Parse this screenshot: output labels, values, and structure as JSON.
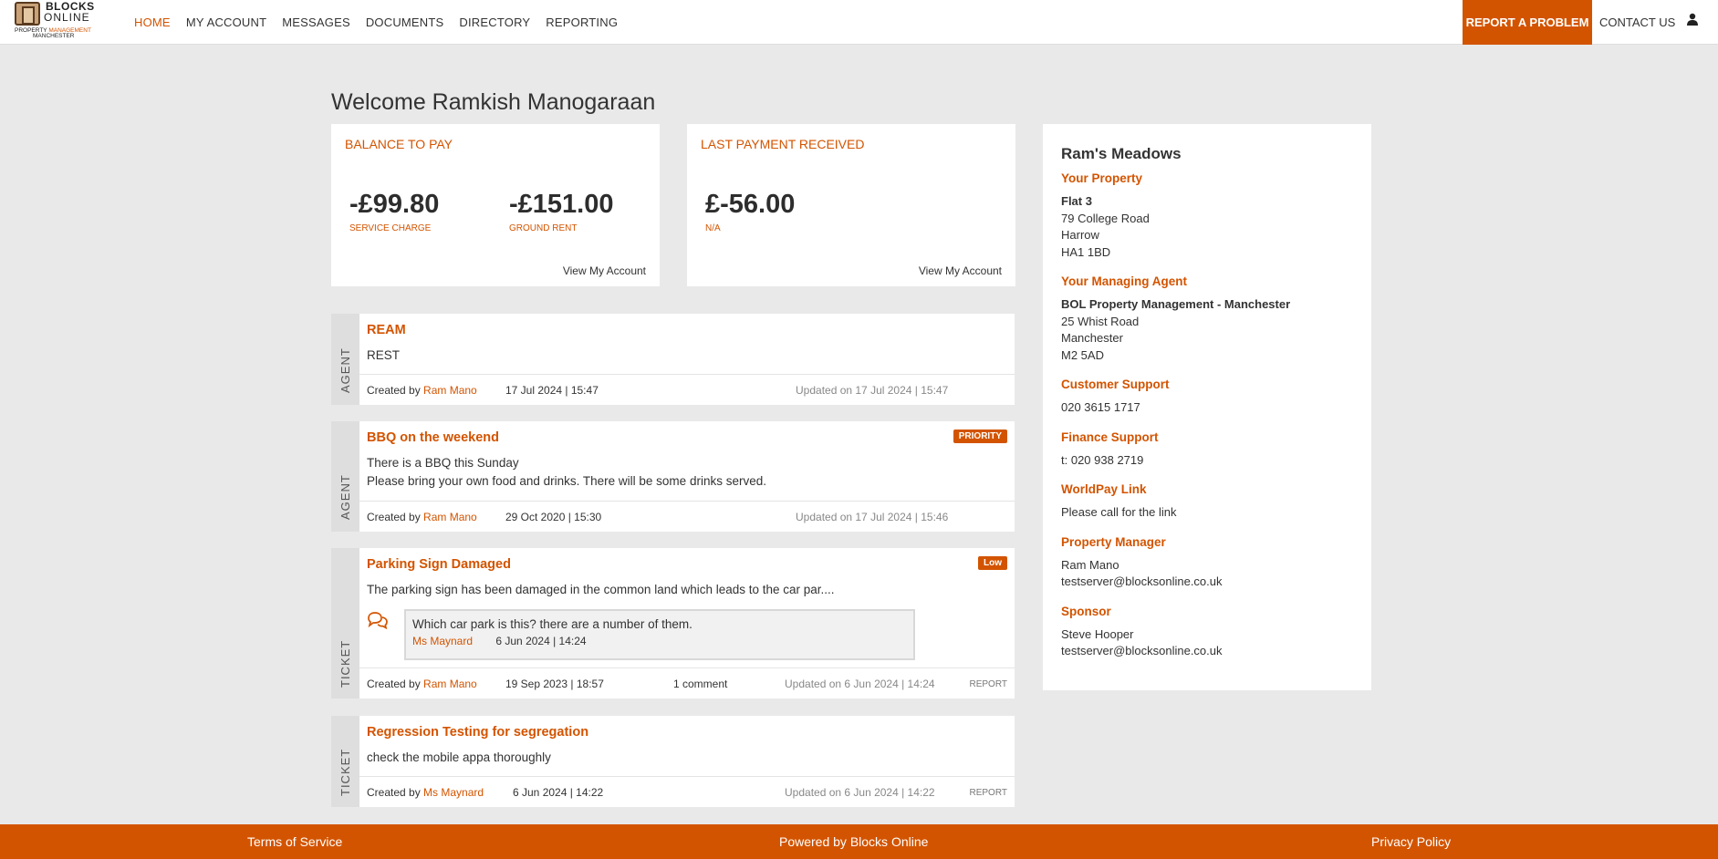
{
  "logo": {
    "line1": "BLOCKS",
    "line2": "ONLINE",
    "line3a": "PROPERTY ",
    "line3b": "MANAGEMENT",
    "line4": "MANCHESTER"
  },
  "nav": {
    "items": [
      {
        "label": "HOME"
      },
      {
        "label": "MY ACCOUNT"
      },
      {
        "label": "MESSAGES"
      },
      {
        "label": "DOCUMENTS"
      },
      {
        "label": "DIRECTORY"
      },
      {
        "label": "REPORTING"
      }
    ],
    "report_problem": "REPORT A PROBLEM",
    "contact_us": "CONTACT US"
  },
  "welcome": "Welcome Ramkish Manogaraan",
  "balance": {
    "heading": "BALANCE TO PAY",
    "service_amount": "-£99.80",
    "service_label": "SERVICE CHARGE",
    "ground_amount": "-£151.00",
    "ground_label": "GROUND RENT",
    "link": "View My Account"
  },
  "last_payment": {
    "heading": "LAST PAYMENT RECEIVED",
    "amount": "£-56.00",
    "label": "N/A",
    "link": "View My Account"
  },
  "feed": [
    {
      "kind": "AGENT",
      "title": "REAM",
      "body": "REST",
      "created_prefix": "Created by",
      "author": "Ram Mano",
      "created": "17 Jul 2024 | 15:47",
      "updated": "Updated on 17 Jul 2024 | 15:47"
    },
    {
      "kind": "AGENT",
      "title": "BBQ on the weekend",
      "badge": "PRIORITY",
      "body1": "There is a BBQ this Sunday",
      "body2": "Please bring your own food and drinks. There will be some drinks served.",
      "created_prefix": "Created by",
      "author": "Ram Mano",
      "created": "29 Oct 2020 | 15:30",
      "updated": "Updated on 17 Jul 2024 | 15:46"
    },
    {
      "kind": "TICKET",
      "title": "Parking Sign Damaged",
      "badge": "Low",
      "body": "The parking sign has been damaged in the common land which leads to the car par....",
      "comment_text": "Which car park is this? there are a number of them.",
      "comment_author": "Ms Maynard",
      "comment_date": "6 Jun 2024 | 14:24",
      "created_prefix": "Created by",
      "author": "Ram Mano",
      "created": "19 Sep 2023 | 18:57",
      "comments": "1 comment",
      "updated": "Updated on 6 Jun 2024 | 14:24",
      "report": "REPORT"
    },
    {
      "kind": "TICKET",
      "title": "Regression Testing for segregation",
      "body": "check the mobile appa thoroughly",
      "created_prefix": "Created by",
      "author": "Ms Maynard",
      "created": "6 Jun 2024 | 14:22",
      "updated": "Updated on 6 Jun 2024 | 14:22",
      "report": "REPORT"
    }
  ],
  "property": {
    "development": "Ram's Meadows",
    "your_property_title": "Your Property",
    "flat": "Flat 3",
    "addr1": "79 College Road",
    "addr2": "Harrow",
    "addr3": "HA1 1BD",
    "agent_title": "Your Managing Agent",
    "agent_name": "BOL Property Management - Manchester",
    "agent_addr1": "25 Whist Road",
    "agent_addr2": "Manchester",
    "agent_addr3": "M2 5AD",
    "customer_title": "Customer Support",
    "customer_phone": "020 3615 1717",
    "finance_title": "Finance Support",
    "finance_phone": "t: 020 938 2719",
    "worldpay_title": "WorldPay Link",
    "worldpay_text": "Please call for the link",
    "pm_title": "Property Manager",
    "pm_name": "Ram Mano",
    "pm_email": "testserver@blocksonline.co.uk",
    "sponsor_title": "Sponsor",
    "sponsor_name": "Steve Hooper",
    "sponsor_email": "testserver@blocksonline.co.uk"
  },
  "footer": {
    "terms": "Terms of Service",
    "powered": "Powered by Blocks Online",
    "privacy": "Privacy Policy"
  },
  "colors": {
    "accent": "#d35400",
    "background": "#e9e9e9"
  },
  "icons": {
    "user": "user-icon",
    "chat": "chat-bubbles-icon"
  }
}
